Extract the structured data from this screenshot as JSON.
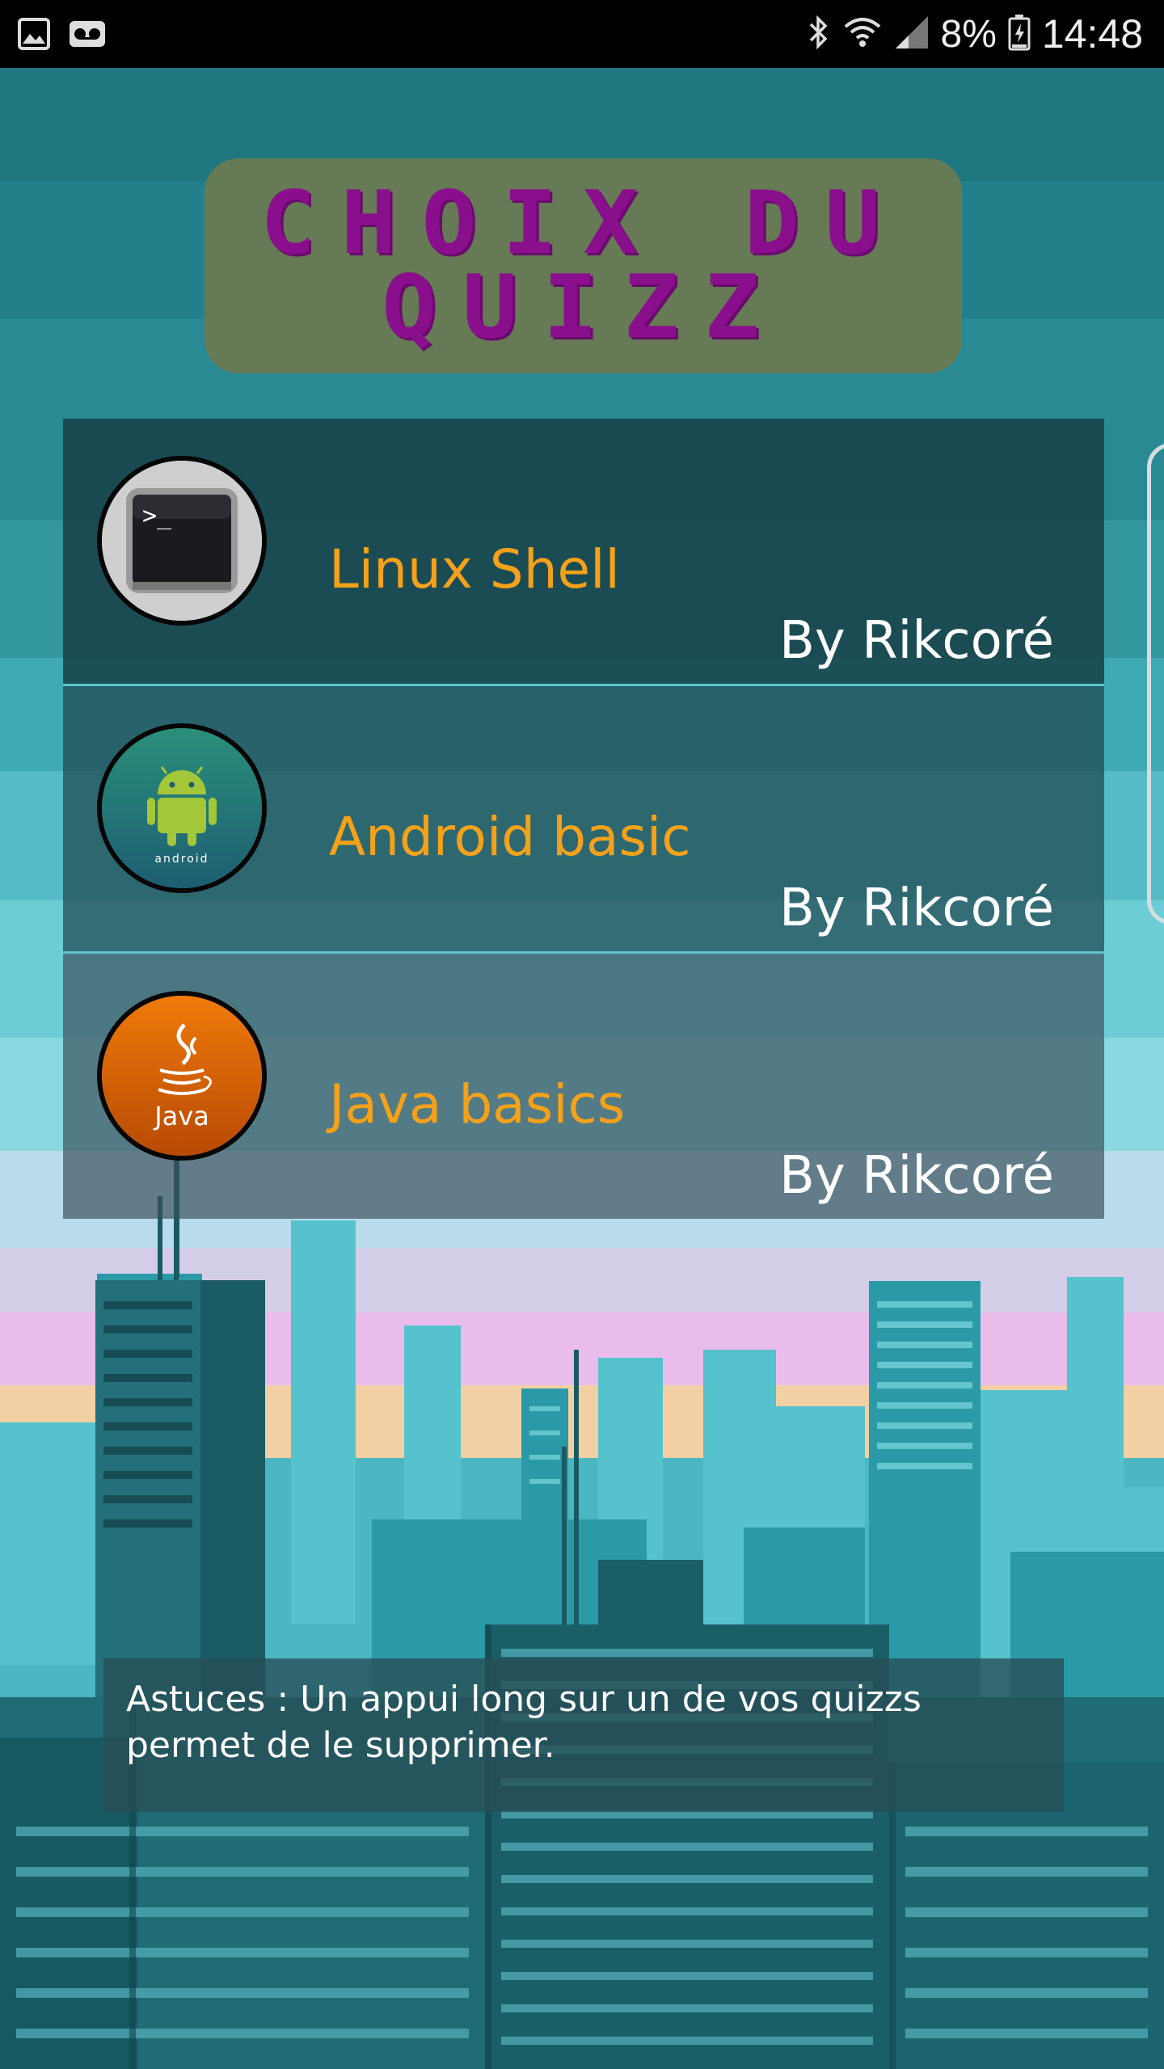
{
  "status_bar": {
    "time": "14:48",
    "battery_percent": "8%",
    "left_icons": [
      "gallery-icon",
      "voicemail-icon"
    ],
    "right_icons": [
      "bluetooth-icon",
      "wifi-icon",
      "signal-icon",
      "battery-icon"
    ]
  },
  "title": {
    "line1": "CHOIX DU",
    "line2": "QUIZZ"
  },
  "quizzes": [
    {
      "name": "Linux Shell",
      "author": "By Rikcoré",
      "icon": "terminal-icon"
    },
    {
      "name": "Android basic",
      "author": "By Rikcoré",
      "icon": "android-icon",
      "icon_label": "android"
    },
    {
      "name": "Java basics",
      "author": "By Rikcoré",
      "icon": "java-icon",
      "icon_label": "Java"
    }
  ],
  "tip": "Astuces : Un appui long sur un de vos quizzs permet de le supprimer.",
  "colors": {
    "title_text": "#8a0f8c",
    "title_bg": "#667a56",
    "quiz_name": "#f5a11a",
    "author": "#ffffff",
    "divider": "#5fc4cc"
  }
}
